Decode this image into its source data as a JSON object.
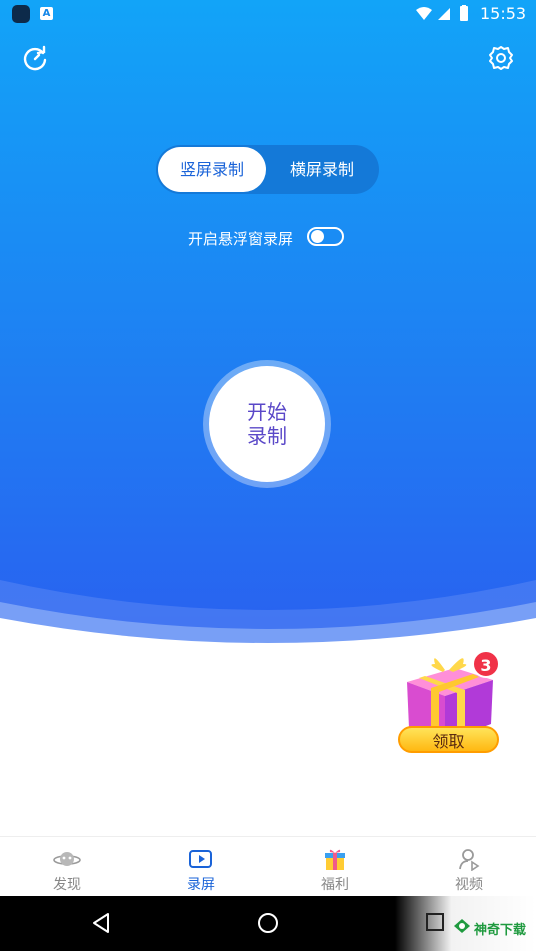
{
  "status_bar": {
    "time": "15:53"
  },
  "header": {
    "refresh_icon": "refresh-icon",
    "settings_icon": "gear-icon"
  },
  "mode_switch": {
    "portrait_label": "竖屏录制",
    "landscape_label": "横屏录制",
    "selected": "portrait"
  },
  "floating": {
    "label": "开启悬浮窗录屏",
    "enabled": false
  },
  "start_button": {
    "line1": "开始",
    "line2": "录制"
  },
  "gift": {
    "badge_count": "3",
    "label": "领取"
  },
  "bottom_nav": {
    "items": [
      {
        "label": "发现",
        "icon": "planet-icon",
        "active": false
      },
      {
        "label": "录屏",
        "icon": "video-icon",
        "active": true
      },
      {
        "label": "福利",
        "icon": "gift-icon",
        "active": false
      },
      {
        "label": "视频",
        "icon": "play-user-icon",
        "active": false
      }
    ]
  },
  "watermark": {
    "text": "神奇下载"
  },
  "colors": {
    "accent": "#1a63d8",
    "hero_top": "#12a4f8",
    "hero_bottom": "#2a5ff0",
    "badge": "#f03248"
  }
}
